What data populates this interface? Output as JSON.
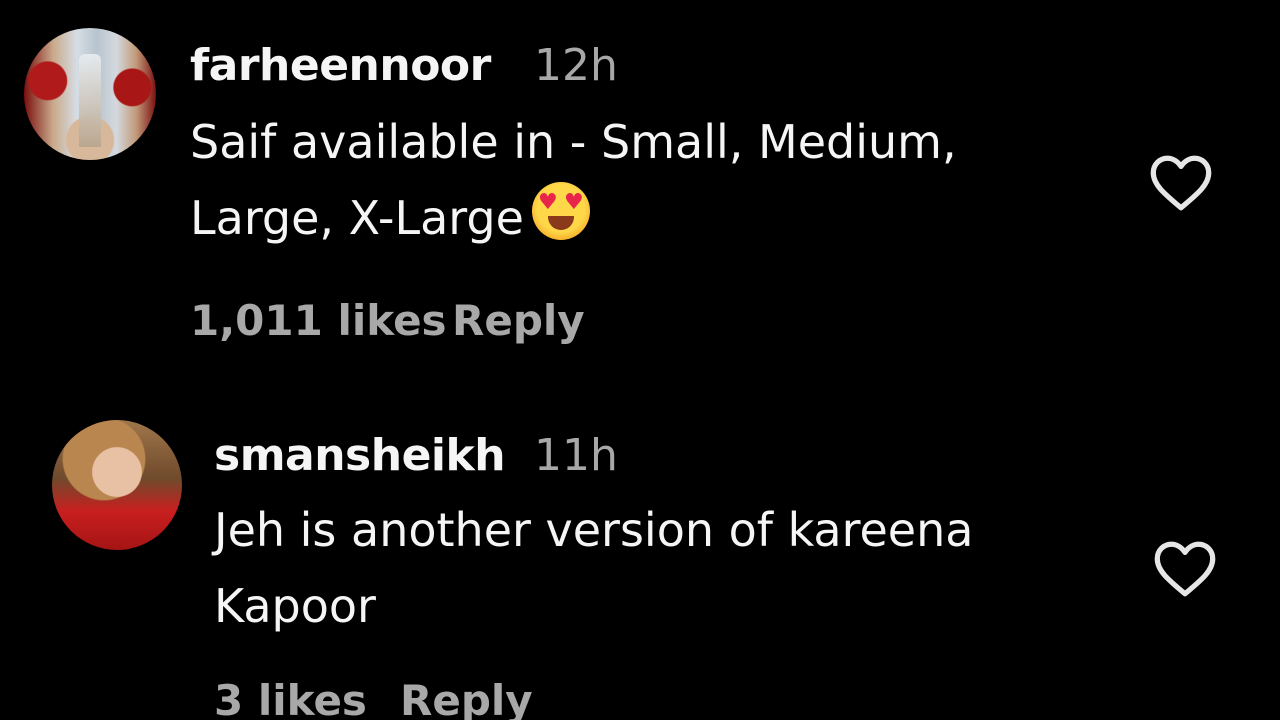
{
  "comments": [
    {
      "username": "farheennoor",
      "time": "12h",
      "text_line1": "Saif available in - Small, Medium,",
      "text_line2": "Large, X-Large",
      "emoji": "smiling-face-with-heart-eyes",
      "likes": "1,011 likes",
      "reply": "Reply"
    },
    {
      "username": "smansheikh",
      "time": "11h",
      "text_line1": "Jeh is another version of kareena",
      "text_line2": "Kapoor",
      "likes": "3 likes",
      "reply": "Reply"
    }
  ],
  "colors": {
    "background": "#000000",
    "primary_text": "#f5f5f5",
    "secondary_text": "#a8a8a8"
  }
}
